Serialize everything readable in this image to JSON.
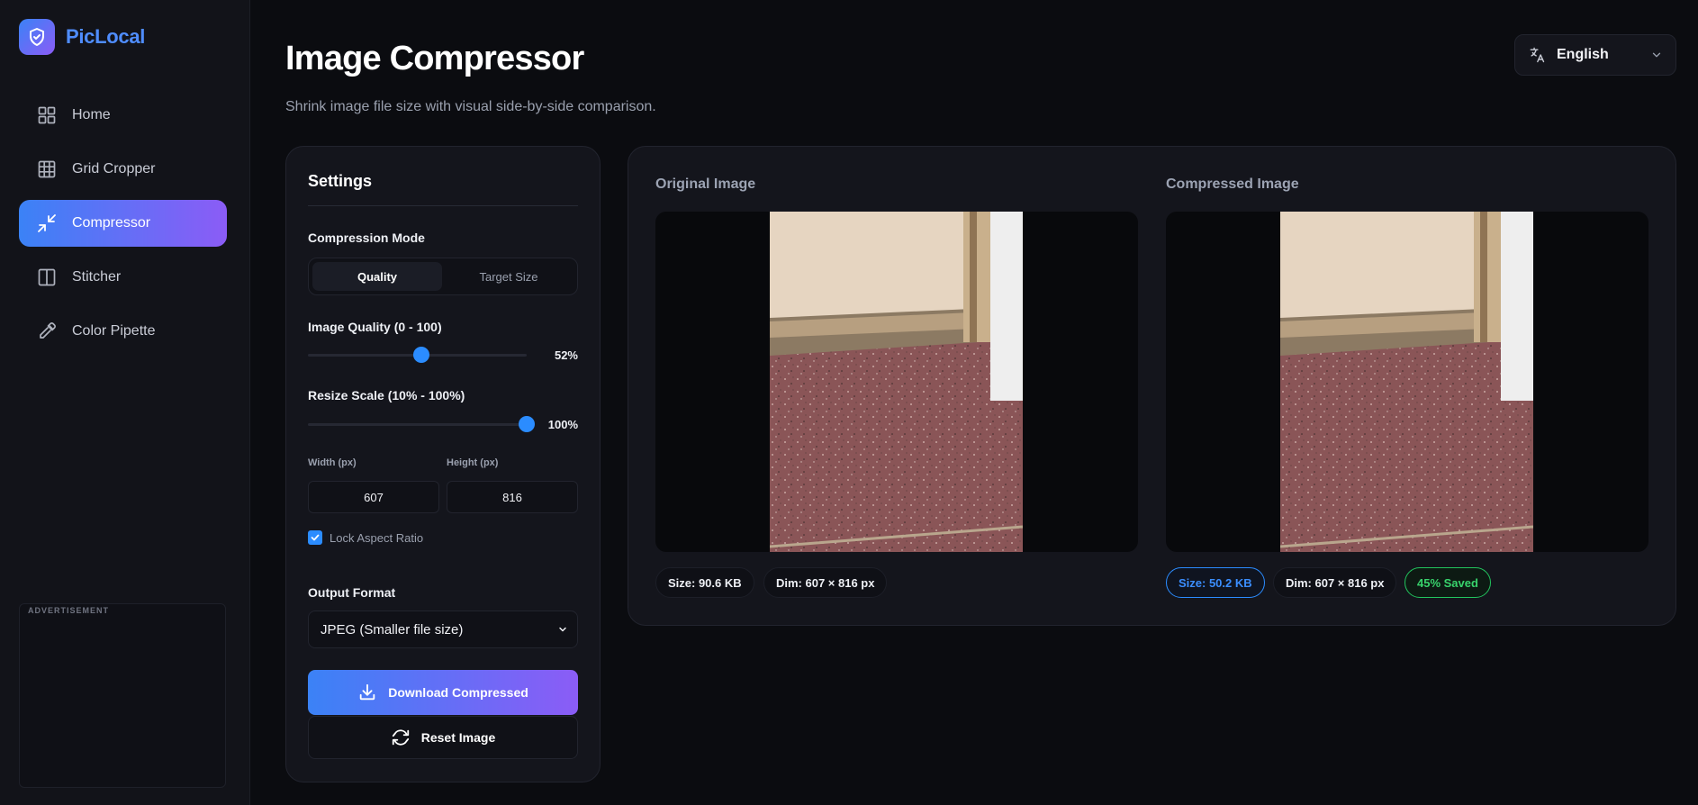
{
  "app": {
    "brand": "PicLocal",
    "accent_start": "#3b82f6",
    "accent_end": "#8b5cf6"
  },
  "sidebar": {
    "items": [
      {
        "label": "Home",
        "icon": "grid-four-icon"
      },
      {
        "label": "Grid Cropper",
        "icon": "grid-nine-icon"
      },
      {
        "label": "Compressor",
        "icon": "minimize-arrows-icon",
        "active": true
      },
      {
        "label": "Stitcher",
        "icon": "split-panel-icon"
      },
      {
        "label": "Color Pipette",
        "icon": "pipette-icon"
      }
    ],
    "ad_label": "ADVERTISEMENT"
  },
  "header": {
    "title": "Image Compressor",
    "subtitle": "Shrink image file size with visual side-by-side comparison.",
    "language": "English"
  },
  "settings": {
    "title": "Settings",
    "mode_label": "Compression Mode",
    "modes": [
      "Quality",
      "Target Size"
    ],
    "active_mode": "Quality",
    "quality_label": "Image Quality (0 - 100)",
    "quality_value": 52,
    "quality_display": "52%",
    "scale_label": "Resize Scale (10% - 100%)",
    "scale_value": 100,
    "scale_display": "100%",
    "width_label": "Width (px)",
    "width_value": "607",
    "height_label": "Height (px)",
    "height_value": "816",
    "lock_label": "Lock Aspect Ratio",
    "lock_checked": true,
    "format_label": "Output Format",
    "format_value": "JPEG (Smaller file size)",
    "download_label": "Download Compressed",
    "reset_label": "Reset Image"
  },
  "preview": {
    "original_title": "Original Image",
    "compressed_title": "Compressed Image",
    "original_size": "Size: 90.6 KB",
    "original_dim": "Dim: 607 × 816 px",
    "compressed_size": "Size: 50.2 KB",
    "compressed_dim": "Dim: 607 × 816 px",
    "saved": "45% Saved"
  }
}
